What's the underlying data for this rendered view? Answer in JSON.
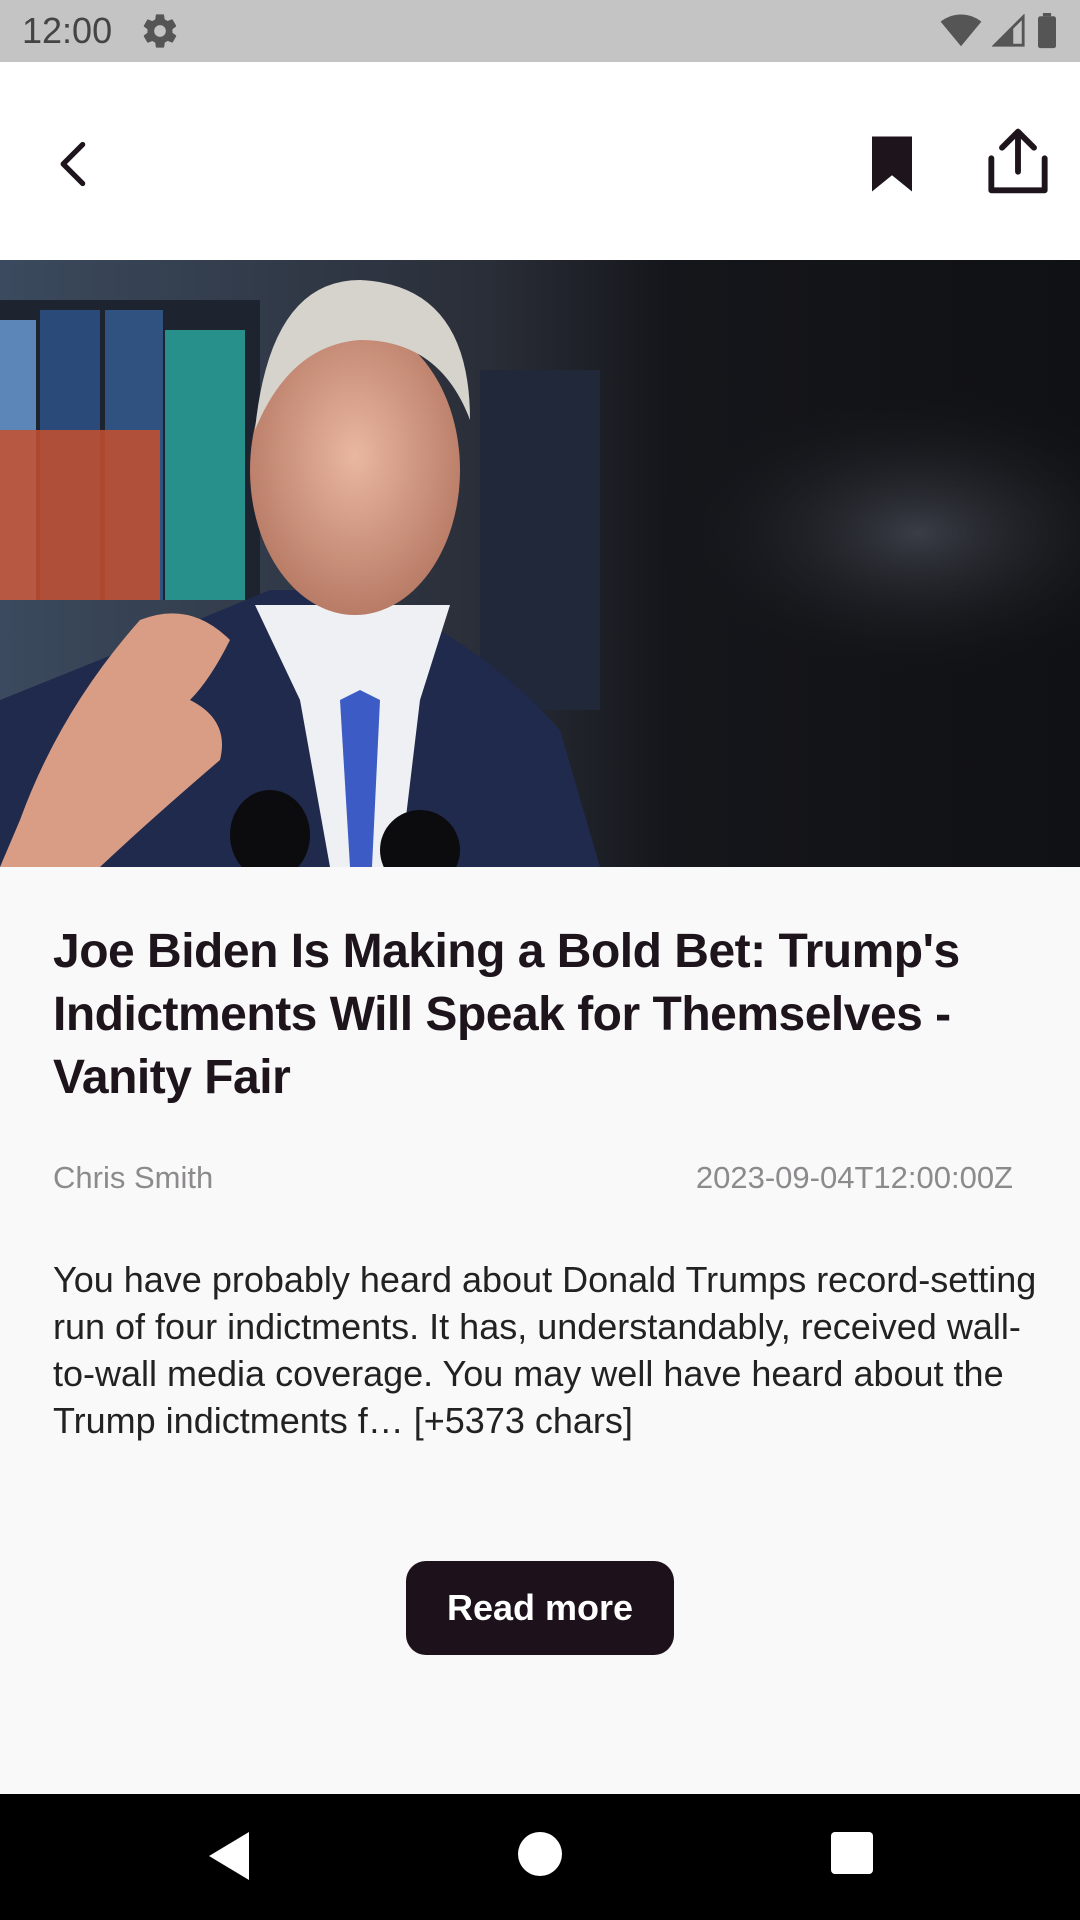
{
  "status_bar": {
    "time": "12:00",
    "icons": [
      "settings-icon",
      "wifi-icon",
      "signal-icon",
      "battery-icon"
    ]
  },
  "app_bar": {
    "icons": [
      "back-arrow-icon",
      "bookmark-icon",
      "share-icon"
    ]
  },
  "article": {
    "image_alt": "Photo of Joe Biden",
    "title": "Joe Biden Is Making a Bold Bet: Trump's Indictments Will Speak for Themselves - Vanity Fair",
    "author": "Chris Smith",
    "published": "2023-09-04T12:00:00Z",
    "content": "You have probably heard about Donald Trumps record-setting run of four indictments. It has, understandably, received wall-to-wall media coverage. You may well have heard about the Trump indictments f… [+5373 chars]",
    "read_more_label": "Read more"
  },
  "nav_bar": {
    "icons": [
      "nav-back-icon",
      "nav-home-icon",
      "nav-recents-icon"
    ]
  },
  "colors": {
    "background": "#f9f9f9",
    "title": "#1d141c",
    "meta": "#8c8a8c",
    "button_bg": "#1d111b",
    "status_bar": "#c4c4c4"
  }
}
